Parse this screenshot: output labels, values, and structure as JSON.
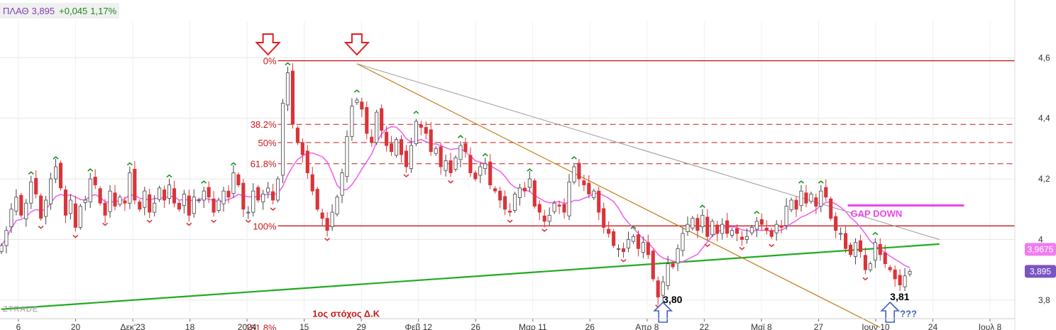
{
  "header": {
    "symbol": "ΠΛΑΘ",
    "price": "3,895",
    "change": "+0,045",
    "change_pct": "1,17%"
  },
  "watermark": "ZTRADE",
  "colors": {
    "up": "#ffffff",
    "down": "#d9343a",
    "ma": "#ee66ee",
    "support": "#22aa22",
    "fib": "#c61a1a",
    "resistance_diag": "#c07a10",
    "long_diag": "#999999",
    "annotation": "#ee44ee"
  },
  "chart_data": {
    "type": "candlestick",
    "y_axis": {
      "range": [
        3.76,
        4.72
      ],
      "ticks": [
        {
          "value": 4.6,
          "label": "4,6"
        },
        {
          "value": 4.4,
          "label": "4,4"
        },
        {
          "value": 4.2,
          "label": "4,2"
        },
        {
          "value": 4.0,
          "label": "4"
        },
        {
          "value": 3.8,
          "label": "3,8"
        }
      ],
      "current_price_label": "3,895",
      "ma_value_label": "3,9675"
    },
    "x_axis": {
      "ticks": [
        "6",
        "20",
        "Δεκ'23",
        "18",
        "2024",
        "15",
        "29",
        "Φεβ 12",
        "26",
        "Μαρ 11",
        "26",
        "Απρ 8",
        "22",
        "Μαϊ 8",
        "27",
        "Ιουν 10",
        "24",
        "Ιουλ 8"
      ]
    },
    "closes": [
      3.98,
      4.03,
      4.1,
      4.14,
      4.08,
      4.12,
      4.19,
      4.15,
      4.07,
      4.13,
      4.2,
      4.24,
      4.17,
      4.08,
      4.13,
      4.04,
      4.11,
      4.13,
      4.2,
      4.18,
      4.12,
      4.08,
      4.16,
      4.11,
      4.14,
      4.12,
      4.22,
      4.13,
      4.1,
      4.16,
      4.09,
      4.12,
      4.17,
      4.13,
      4.18,
      4.12,
      4.1,
      4.15,
      4.08,
      4.14,
      4.13,
      4.16,
      4.14,
      4.09,
      4.13,
      4.16,
      4.14,
      4.22,
      4.18,
      4.1,
      4.09,
      4.16,
      4.13,
      4.15,
      4.17,
      4.13,
      4.2,
      4.45,
      4.55,
      4.38,
      4.32,
      4.28,
      4.22,
      4.16,
      4.1,
      4.07,
      4.03,
      4.09,
      4.14,
      4.22,
      4.34,
      4.44,
      4.46,
      4.43,
      4.35,
      4.32,
      4.42,
      4.36,
      4.31,
      4.29,
      4.33,
      4.28,
      4.24,
      4.31,
      4.39,
      4.37,
      4.35,
      4.29,
      4.3,
      4.24,
      4.26,
      4.22,
      4.27,
      4.31,
      4.29,
      4.22,
      4.2,
      4.24,
      4.25,
      4.18,
      4.16,
      4.13,
      4.1,
      4.09,
      4.15,
      4.17,
      4.16,
      4.2,
      4.11,
      4.09,
      4.06,
      4.08,
      4.12,
      4.11,
      4.09,
      4.19,
      4.24,
      4.2,
      4.18,
      4.15,
      4.16,
      4.09,
      4.04,
      4.02,
      3.98,
      3.97,
      3.96,
      4.0,
      4.01,
      3.97,
      3.99,
      3.95,
      3.87,
      3.81,
      3.86,
      3.92,
      3.91,
      3.97,
      4.02,
      4.05,
      4.07,
      4.03,
      4.08,
      4.01,
      4.06,
      4.02,
      4.05,
      4.02,
      4.03,
      4.02,
      4.0,
      4.01,
      4.04,
      4.06,
      4.05,
      4.03,
      4.01,
      4.05,
      4.04,
      4.11,
      4.13,
      4.1,
      4.16,
      4.12,
      4.15,
      4.11,
      4.16,
      4.14,
      4.07,
      4.03,
      4.02,
      3.97,
      3.95,
      3.99,
      3.96,
      3.9,
      3.92,
      3.99,
      3.95,
      3.92,
      3.9,
      3.87,
      3.85,
      3.88,
      3.895
    ],
    "series": [
      {
        "kind": "ma"
      },
      {
        "kind": "support_line",
        "points": [
          [
            0,
            3.77
          ],
          [
            190,
            3.985
          ]
        ]
      },
      {
        "kind": "diagonal_resistance",
        "points": [
          [
            72,
            4.58
          ],
          [
            178,
            3.71
          ]
        ]
      },
      {
        "kind": "long_diagonal",
        "points": [
          [
            72,
            4.58
          ],
          [
            190,
            4.0
          ]
        ]
      }
    ],
    "fibonacci": {
      "from_index": 56,
      "levels": [
        {
          "label": "0%",
          "value": 4.59
        },
        {
          "label": "38.2%",
          "value": 4.38
        },
        {
          "label": "50%",
          "value": 4.32
        },
        {
          "label": "61.8%",
          "value": 4.25
        },
        {
          "label": "100%",
          "value": 4.045
        },
        {
          "label": "161.8%",
          "value": 3.71
        }
      ]
    },
    "annotations": [
      {
        "id": "low1",
        "text": "3,80",
        "index": 134,
        "value": 3.79
      },
      {
        "id": "low2",
        "text": "3,81",
        "index": 180,
        "value": 3.8
      },
      {
        "id": "question",
        "text": "???",
        "index": 182,
        "value": 3.745
      },
      {
        "id": "target",
        "text": "1ος στόχος Δ.Κ",
        "index": 63,
        "value": 3.745
      },
      {
        "id": "gap",
        "text": "GAP DOWN",
        "index": 172,
        "value": 4.075
      }
    ]
  }
}
